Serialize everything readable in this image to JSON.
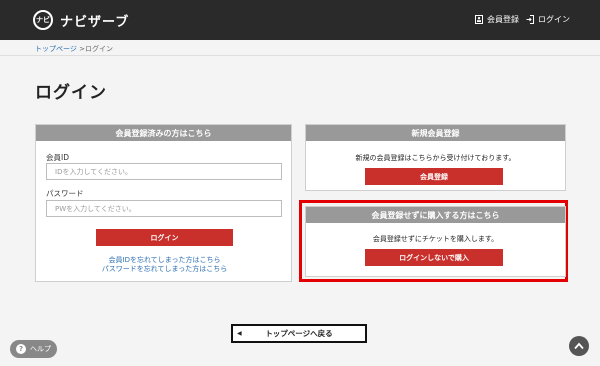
{
  "header": {
    "logo_badge": "ナビ",
    "logo_text": "ナビザーブ",
    "member_register": "会員登録",
    "login": "ログイン"
  },
  "breadcrumb": {
    "home": "トップページ",
    "separator": ">",
    "current": "ログイン"
  },
  "page_title": "ログイン",
  "login_panel": {
    "title": "会員登録済みの方はこちら",
    "member_id_label": "会員ID",
    "member_id_placeholder": "IDを入力してください。",
    "password_label": "パスワード",
    "password_placeholder": "PWを入力してください。",
    "login_button": "ログイン",
    "forgot_id": "会員IDを忘れてしまった方はこちら",
    "forgot_password": "パスワードを忘れてしまった方はこちら"
  },
  "register_panel": {
    "title": "新規会員登録",
    "message": "新規の会員登録はこちらから受け付けております。",
    "button": "会員登録"
  },
  "guest_panel": {
    "title": "会員登録せずに購入する方はこちら",
    "message": "会員登録せずにチケットを購入します。",
    "button": "ログインしないで購入"
  },
  "back_button": "トップページへ戻る",
  "help_button": "ヘルプ",
  "colors": {
    "header_bg": "#2a2a2a",
    "panel_head": "#999999",
    "button_red": "#c9302c",
    "highlight": "#e40000",
    "link": "#2d6fb3"
  }
}
